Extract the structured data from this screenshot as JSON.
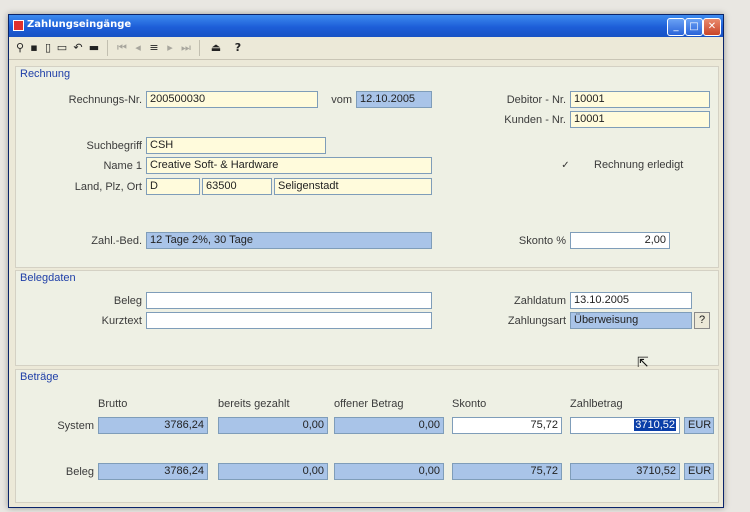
{
  "window": {
    "title": "Zahlungseingänge",
    "controls": {
      "minimize": "_",
      "maximize": "□",
      "close": "✕"
    }
  },
  "toolbar": {
    "icons": [
      {
        "name": "binoculars-icon",
        "glyph": "⚲"
      },
      {
        "name": "save-icon",
        "glyph": "▪"
      },
      {
        "name": "new-document-icon",
        "glyph": "▯"
      },
      {
        "name": "open-icon",
        "glyph": "▭"
      },
      {
        "name": "undo-icon",
        "glyph": "↶"
      },
      {
        "name": "delete-icon",
        "glyph": "▬"
      },
      {
        "name": "first-record-icon",
        "glyph": "⏮"
      },
      {
        "name": "prev-record-icon",
        "glyph": "◂"
      },
      {
        "name": "list-icon",
        "glyph": "≡"
      },
      {
        "name": "next-record-icon",
        "glyph": "▸"
      },
      {
        "name": "last-record-icon",
        "glyph": "⏭"
      },
      {
        "name": "exit-icon",
        "glyph": "⏏"
      },
      {
        "name": "help-icon",
        "glyph": "?"
      }
    ]
  },
  "rechnung": {
    "title": "Rechnung",
    "rechnungs_nr_label": "Rechnungs-Nr.",
    "rechnungs_nr": "200500030",
    "vom_label": "vom",
    "vom": "12.10.2005",
    "debitor_label": "Debitor - Nr.",
    "debitor": "10001",
    "kunden_label": "Kunden - Nr.",
    "kunden": "10001",
    "suchbegriff_label": "Suchbegriff",
    "suchbegriff": "CSH",
    "name1_label": "Name 1",
    "name1": "Creative Soft- & Hardware",
    "land_label": "Land, Plz, Ort",
    "land": "D",
    "plz": "63500",
    "ort": "Seligenstadt",
    "erledigt_check": "✓",
    "erledigt_label": "Rechnung erledigt",
    "zahl_bed_label": "Zahl.-Bed.",
    "zahl_bed": "12 Tage 2%, 30 Tage",
    "skonto_label": "Skonto %",
    "skonto": "2,00"
  },
  "belegdaten": {
    "title": "Belegdaten",
    "beleg_label": "Beleg",
    "beleg": "",
    "kurztext_label": "Kurztext",
    "kurztext": "",
    "zahldatum_label": "Zahldatum",
    "zahldatum": "13.10.2005",
    "zahlungsart_label": "Zahlungsart",
    "zahlungsart": "Überweisung",
    "help_button": "?"
  },
  "betraege": {
    "title": "Beträge",
    "headers": [
      "Brutto",
      "bereits gezahlt",
      "offener Betrag",
      "Skonto",
      "Zahlbetrag"
    ],
    "rows": [
      {
        "label": "System",
        "values": [
          "3786,24",
          "0,00",
          "0,00",
          "75,72",
          "3710,52"
        ],
        "currency": "EUR"
      },
      {
        "label": "Beleg",
        "values": [
          "3786,24",
          "0,00",
          "0,00",
          "75,72",
          "3710,52"
        ],
        "currency": "EUR"
      }
    ]
  }
}
